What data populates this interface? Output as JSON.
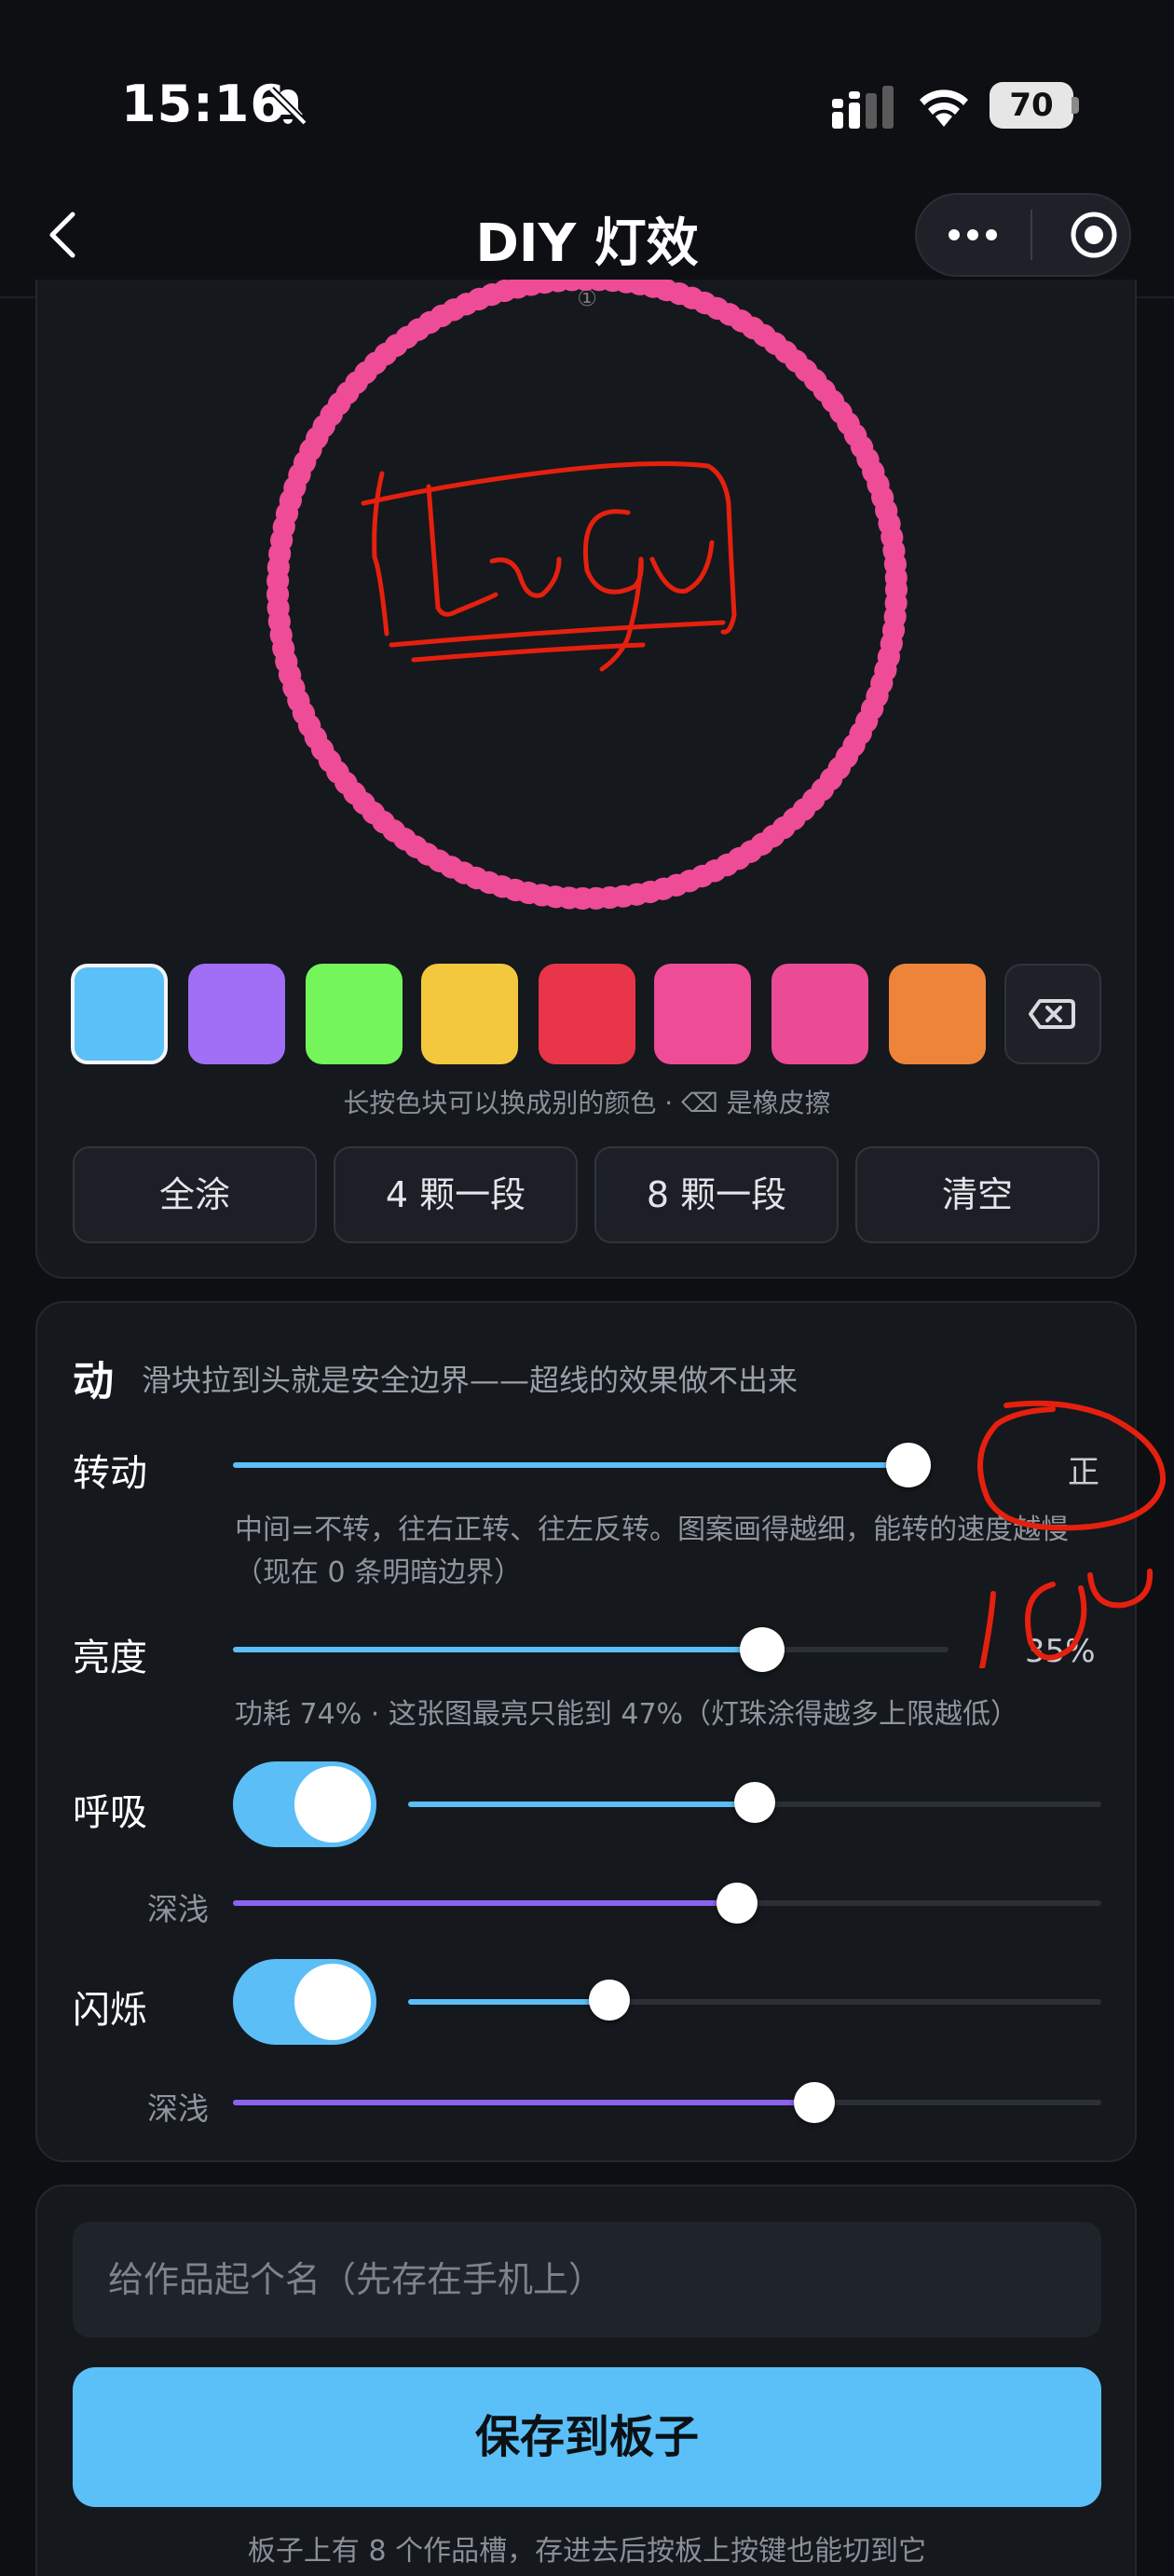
{
  "status_bar": {
    "time": "15:16",
    "battery": "70"
  },
  "nav": {
    "title": "DIY 灯效"
  },
  "canvas": {
    "ring_color": "#ee4c96",
    "drawing_color": "#e5200f",
    "top_mark": "①"
  },
  "palette": {
    "swatches": [
      {
        "color": "#5bc0f7",
        "selected": true
      },
      {
        "color": "#a16ef6"
      },
      {
        "color": "#74f55a"
      },
      {
        "color": "#f4c83e"
      },
      {
        "color": "#e8354a"
      },
      {
        "color": "#ee4c96"
      },
      {
        "color": "#ea4b94"
      },
      {
        "color": "#ee8439"
      }
    ],
    "hint": "长按色块可以换成别的颜色 · ⌫ 是橡皮擦",
    "buttons": [
      "全涂",
      "4 颗一段",
      "8 颗一段",
      "清空"
    ]
  },
  "motion": {
    "title": "动",
    "subtitle": "滑块拉到头就是安全边界——超线的效果做不出来",
    "rotation": {
      "label": "转动",
      "value_text": "正",
      "position": 0.985,
      "note_1": "中间=不转，往右正转、往左反转。图案画得越细，能转的速度越慢",
      "note_2": "（现在 0 条明暗边界）"
    },
    "brightness": {
      "label": "亮度",
      "value_text": "35%",
      "position": 0.74,
      "note": "功耗 74% · 这张图最亮只能到 47%（灯珠涂得越多上限越低）"
    },
    "breathe": {
      "label": "呼吸",
      "on": true,
      "position": 0.5,
      "depth_label": "深浅",
      "depth_position": 0.58
    },
    "flash": {
      "label": "闪烁",
      "on": true,
      "position": 0.29,
      "depth_label": "深浅",
      "depth_position": 0.67
    }
  },
  "save": {
    "name_placeholder": "给作品起个名（先存在手机上）",
    "button": "保存到板子",
    "footnote": "板子上有 8 个作品槽，存进去后按板上按键也能切到它"
  },
  "annotations": {
    "handwritten_text": "100"
  }
}
